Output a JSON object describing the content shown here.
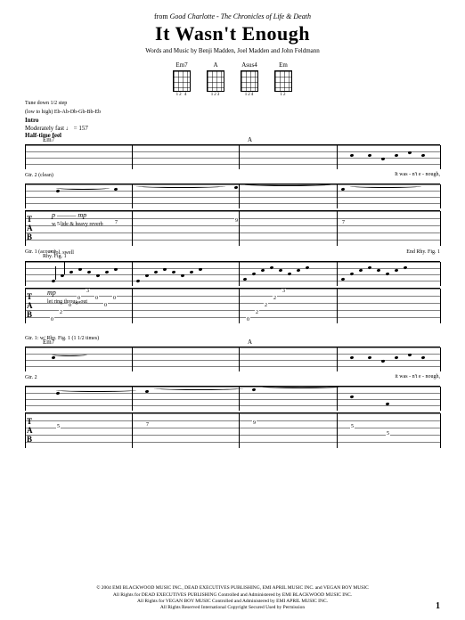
{
  "header": {
    "from_prefix": "from",
    "artist": "Good Charlotte",
    "album_dash": " - ",
    "album": "The Chronicles of Life & Death",
    "title": "It Wasn't Enough",
    "credits": "Words and Music by Benji Madden, Joel Madden and John Feldmann"
  },
  "chords": [
    {
      "name": "Em7",
      "fingering": "12  4"
    },
    {
      "name": "A",
      "fingering": "123"
    },
    {
      "name": "Asus4",
      "fingering": "124"
    },
    {
      "name": "Em",
      "fingering": "12"
    }
  ],
  "performance": {
    "tuning_note_1": "Tune down 1/2 step",
    "tuning_note_2": "(low to high) Eb-Ab-Db-Gb-Bb-Eb",
    "section": "Intro",
    "tempo": "Moderately fast ♩ = 157",
    "feel": "Half-time feel"
  },
  "system1": {
    "chord_a": "Em7",
    "chord_b": "A",
    "lyric": "It   was - n't   e - nough,",
    "gtr2_label": "Gtr. 2 (clean)",
    "dynamic2": "p ——— mp",
    "effect2": "w/ slide & heavy reverb",
    "vol_swell": "*Vol. swell",
    "gtr1_label": "Gtr. 1 (acous.)",
    "dynamic1": "mp",
    "ring_note": "let ring throughout",
    "rhy_fig": "Rhy. Fig. 1",
    "end_rhy": "End Rhy. Fig. 1"
  },
  "system2": {
    "direction": "Gtr. 1: w/ Rhy. Fig. 1 (1 1/2 times)",
    "chord_a": "Em7",
    "chord_b": "A",
    "lyric": "it   was - n't   e - nough,",
    "gtr2_label": "Gtr. 2"
  },
  "copyright": {
    "line1": "© 2004 EMI BLACKWOOD MUSIC INC., DEAD EXECUTIVES PUBLISHING, EMI APRIL MUSIC INC. and VEGAN BOY MUSIC",
    "line2": "All Rights for DEAD EXECUTIVES PUBLISHING Controlled and Administered by EMI BLACKWOOD MUSIC INC.",
    "line3": "All Rights for VEGAN BOY MUSIC Controlled and Administered by EMI APRIL MUSIC INC.",
    "line4": "All Rights Reserved   International Copyright Secured   Used by Permission"
  },
  "page_number": "1",
  "chart_data": {
    "type": "table",
    "description": "Guitar tablature sheet music",
    "song": "It Wasn't Enough",
    "artist": "Good Charlotte",
    "album": "The Chronicles of Life & Death",
    "key_chords": [
      "Em7",
      "A",
      "Asus4",
      "Em"
    ],
    "tempo_bpm": 157,
    "tuning": "Eb-Ab-Db-Gb-Bb-Eb (half step down)",
    "sections": [
      "Intro"
    ],
    "guitars": [
      "Gtr. 1 (acous.)",
      "Gtr. 2 (clean)"
    ]
  }
}
